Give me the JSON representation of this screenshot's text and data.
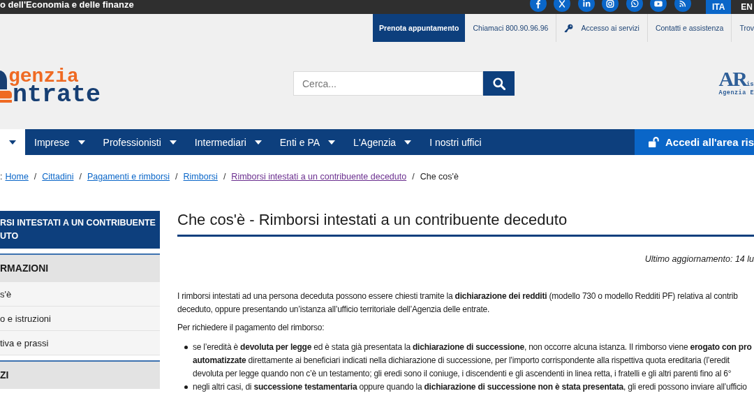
{
  "top_bar": {
    "title": "o dell'Economia e delle finanze",
    "languages": [
      {
        "label": "ITA",
        "selected": true
      },
      {
        "label": "EN",
        "selected": false
      }
    ]
  },
  "service_bar": {
    "items": [
      {
        "label": "Prenota appuntamento",
        "kind": "primary"
      },
      {
        "label": "Chiamaci 800.90.96.96",
        "kind": "plain"
      },
      {
        "label": "Accesso ai servizi",
        "kind": "login"
      },
      {
        "label": "Contatti e assistenza",
        "kind": "plain"
      },
      {
        "label": "Trov",
        "kind": "plain"
      }
    ]
  },
  "header": {
    "logo": {
      "line1": "genzia",
      "line2": "ntrate"
    },
    "search": {
      "placeholder": "Cerca..."
    },
    "partner_logo": {
      "mark": "AR",
      "suffix": "is",
      "caption": "Agenzia E"
    }
  },
  "nav": {
    "items": [
      {
        "selected": true,
        "dropdown": true
      },
      {
        "label": "Imprese",
        "selected": false,
        "dropdown": true
      },
      {
        "label": "Professionisti",
        "selected": false,
        "dropdown": true
      },
      {
        "label": "Intermediari",
        "selected": false,
        "dropdown": true
      },
      {
        "label": "Enti e PA",
        "selected": false,
        "dropdown": true
      },
      {
        "label": "L'Agenzia",
        "selected": false,
        "dropdown": true
      },
      {
        "label": "I nostri uffici",
        "selected": false,
        "dropdown": false
      }
    ],
    "login_button": "Accedi all'area ris"
  },
  "breadcrumb": {
    "lead": ":",
    "separator": "/",
    "items": [
      {
        "label": "Home",
        "kind": "link",
        "visited": false
      },
      {
        "label": "Cittadini",
        "kind": "link",
        "visited": false
      },
      {
        "label": "Pagamenti e rimborsi",
        "kind": "link",
        "visited": false
      },
      {
        "label": "Rimborsi",
        "kind": "link",
        "visited": false
      },
      {
        "label": "Rimborsi intestati a un contribuente deceduto",
        "kind": "link",
        "visited": true
      },
      {
        "label": "Che cos'è",
        "kind": "current",
        "visited": false
      }
    ]
  },
  "sidebar": {
    "title_lines": [
      "RSI INTESTATI A UN CONTRIBUENTE",
      "UTO"
    ],
    "sections": [
      {
        "title": "RMAZIONI",
        "items": [
          "s'è",
          "o e istruzioni",
          "tiva e prassi"
        ]
      },
      {
        "title": "ZI"
      }
    ]
  },
  "main": {
    "title": "Che cos'è - Rimborsi intestati a un contribuente deceduto",
    "updated": "Ultimo aggiornamento: 14 lu",
    "intro_lines": [
      "I rimborsi intestati ad una persona deceduta possono essere chiesti tramite la **dichiarazione dei redditi** (modello 730 o modello Redditi PF) relativa al contrib",
      "deceduto, oppure presentando un’istanza all’ufficio territoriale dell’Agenzia delle entrate."
    ],
    "lead": "Per richiedere il pagamento del rimborso:",
    "bullets": [
      {
        "lines": [
          "se l’eredità è **devoluta per legge** ed è stata già presentata la **dichiarazione di successione**, non occorre alcuna istanza. Il rimborso viene **erogato con pro**",
          "**automatizzate** direttamente ai beneficiari indicati nella dichiarazione di successione, per l’importo corrispondente alla rispettiva quota ereditaria (l’eredit",
          "devoluta per legge quando non c’è un testamento; gli eredi sono il coniuge, i discendenti e gli ascendenti in linea retta, i fratelli e gli altri parenti fino al 6°"
        ]
      },
      {
        "lines": [
          "negli altri casi, di **successione testamentaria** oppure quando la **dichiarazione di successione non è stata presentata**, gli eredi possono inviare all’ufficio"
        ]
      }
    ]
  }
}
